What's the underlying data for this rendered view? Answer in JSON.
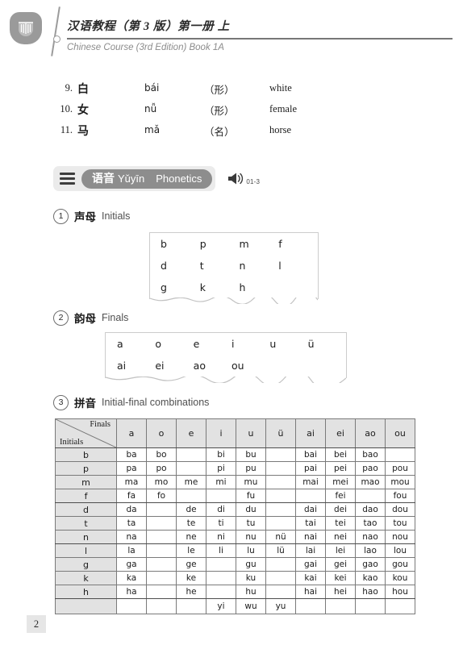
{
  "header": {
    "logo_icon": "book-emblem-icon",
    "title_cn": "汉语教程（第 3 版）第一册 上",
    "subtitle_en": "Chinese Course (3rd Edition) Book 1A"
  },
  "vocabulary": {
    "items": [
      {
        "num": "9.",
        "hanzi": "白",
        "pinyin": "bái",
        "pos": "（形）",
        "english": "white"
      },
      {
        "num": "10.",
        "hanzi": "女",
        "pinyin": "nǚ",
        "pos": "（形）",
        "english": "female"
      },
      {
        "num": "11.",
        "hanzi": "马",
        "pinyin": "mǎ",
        "pos": "（名）",
        "english": "horse"
      }
    ]
  },
  "section": {
    "menu_icon": "hamburger-icon",
    "title_cn": "语音",
    "title_pinyin": "Yǔyīn",
    "title_en": "Phonetics",
    "audio_icon": "speaker-icon",
    "audio_track": "01-3"
  },
  "subsections": {
    "initials": {
      "num": "1",
      "title_cn": "声母",
      "title_en": "Initials"
    },
    "finals": {
      "num": "2",
      "title_cn": "韵母",
      "title_en": "Finals"
    },
    "pinyin": {
      "num": "3",
      "title_cn": "拼音",
      "title_en": "Initial-final combinations"
    }
  },
  "initials_box": {
    "rows": [
      [
        "b",
        "p",
        "m",
        "f"
      ],
      [
        "d",
        "t",
        "n",
        "l"
      ],
      [
        "g",
        "k",
        "h",
        ""
      ]
    ]
  },
  "finals_box": {
    "rows": [
      [
        "a",
        "o",
        "e",
        "i",
        "u",
        "ü"
      ],
      [
        "ai",
        "ei",
        "ao",
        "ou",
        "",
        ""
      ]
    ]
  },
  "combination_table": {
    "corner_top": "Finals",
    "corner_bottom": "Initials",
    "columns": [
      "a",
      "o",
      "e",
      "i",
      "u",
      "ü",
      "ai",
      "ei",
      "ao",
      "ou"
    ],
    "rows": [
      {
        "initial": "b",
        "cells": [
          "ba",
          "bo",
          "",
          "bi",
          "bu",
          "",
          "bai",
          "bei",
          "bao",
          ""
        ]
      },
      {
        "initial": "p",
        "cells": [
          "pa",
          "po",
          "",
          "pi",
          "pu",
          "",
          "pai",
          "pei",
          "pao",
          "pou"
        ]
      },
      {
        "initial": "m",
        "cells": [
          "ma",
          "mo",
          "me",
          "mi",
          "mu",
          "",
          "mai",
          "mei",
          "mao",
          "mou"
        ]
      },
      {
        "initial": "f",
        "cells": [
          "fa",
          "fo",
          "",
          "",
          "fu",
          "",
          "",
          "fei",
          "",
          "fou"
        ]
      },
      {
        "initial": "d",
        "cells": [
          "da",
          "",
          "de",
          "di",
          "du",
          "",
          "dai",
          "dei",
          "dao",
          "dou"
        ]
      },
      {
        "initial": "t",
        "cells": [
          "ta",
          "",
          "te",
          "ti",
          "tu",
          "",
          "tai",
          "tei",
          "tao",
          "tou"
        ]
      },
      {
        "initial": "n",
        "cells": [
          "na",
          "",
          "ne",
          "ni",
          "nu",
          "nü",
          "nai",
          "nei",
          "nao",
          "nou"
        ]
      },
      {
        "initial": "l",
        "cells": [
          "la",
          "",
          "le",
          "li",
          "lu",
          "lü",
          "lai",
          "lei",
          "lao",
          "lou"
        ]
      },
      {
        "initial": "g",
        "cells": [
          "ga",
          "",
          "ge",
          "",
          "gu",
          "",
          "gai",
          "gei",
          "gao",
          "gou"
        ]
      },
      {
        "initial": "k",
        "cells": [
          "ka",
          "",
          "ke",
          "",
          "ku",
          "",
          "kai",
          "kei",
          "kao",
          "kou"
        ]
      },
      {
        "initial": "h",
        "cells": [
          "ha",
          "",
          "he",
          "",
          "hu",
          "",
          "hai",
          "hei",
          "hao",
          "hou"
        ]
      },
      {
        "initial": "",
        "cells": [
          "",
          "",
          "",
          "yi",
          "wu",
          "yu",
          "",
          "",
          "",
          ""
        ]
      }
    ]
  },
  "footer": {
    "page_number": "2"
  },
  "colors": {
    "banner_pill": "#8d8d8d",
    "banner_shell": "#ebebeb",
    "table_header": "#e2e2e2",
    "logo": "#9a9a9a"
  }
}
